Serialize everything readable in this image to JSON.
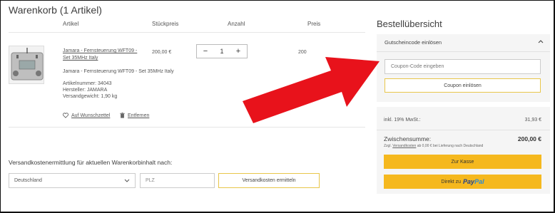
{
  "cart": {
    "title": "Warenkorb (1 Artikel)",
    "columns": [
      "Artikel",
      "Stückpreis",
      "Anzahl",
      "Preis"
    ],
    "item": {
      "name_link": "Jamara - Fernsteuerung WFT09 - Set 35MHz Italy",
      "description": "Jamara - Fernsteuerung WFT09 - Set 35MHz Italy",
      "unit_price": "200,00 €",
      "quantity": "1",
      "total_partial": "200",
      "details": [
        {
          "label": "Artikelnummer:",
          "value": "34043"
        },
        {
          "label": "Hersteller:",
          "value": "JAMARA"
        },
        {
          "label": "Versandgewicht:",
          "value": "1,90 kg"
        }
      ],
      "wishlist_label": "Auf Wunschzettel",
      "remove_label": "Entfernen"
    }
  },
  "shipping": {
    "title": "Versandkostenermittlung für aktuellen Warenkorbinhalt nach:",
    "country_value": "Deutschland",
    "plz_placeholder": "PLZ",
    "button_label": "Versandkosten ermitteln"
  },
  "overview": {
    "title": "Bestellübersicht",
    "coupon_header": "Gutscheincode einlösen",
    "coupon_placeholder": "Coupon-Code eingeben",
    "coupon_button": "Coupon einlösen",
    "vat_label": "inkl. 19% MwSt.:",
    "vat_value": "31,93 €",
    "subtotal_label": "Zwischensumme:",
    "subtotal_value": "200,00 €",
    "shipping_note_prefix": "Zzgl.",
    "shipping_note_link": "Versandkosten",
    "shipping_note_suffix": "ab 0,00 € bei Lieferung nach Deutschland",
    "checkout_button": "Zur Kasse",
    "paypal_prefix": "Direkt zu",
    "paypal_brand_1": "Pay",
    "paypal_brand_2": "Pal"
  },
  "colors": {
    "accent_yellow": "#f5b81e",
    "arrow_red": "#e8121b",
    "panel_bg": "#f5f5f5"
  },
  "icons": {
    "minus": "minus-icon",
    "plus": "plus-icon",
    "heart": "heart-icon",
    "trash": "trash-icon",
    "chevron_down": "chevron-down-icon",
    "chevron_up": "chevron-up-icon"
  }
}
